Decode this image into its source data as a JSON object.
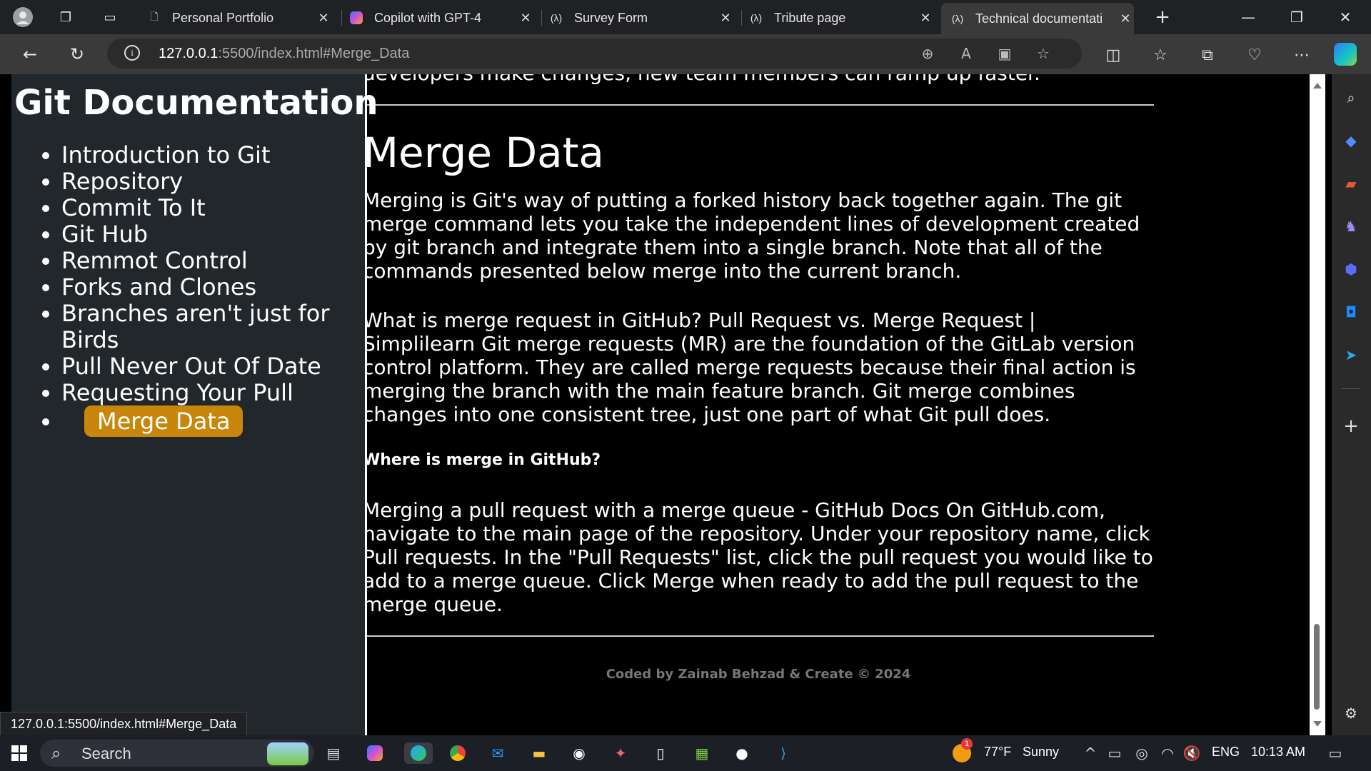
{
  "browser": {
    "tabs": [
      {
        "title": "Personal Portfolio",
        "icon": "page-icon"
      },
      {
        "title": "Copilot with GPT-4",
        "icon": "copilot-icon"
      },
      {
        "title": "Survey Form",
        "icon": "codepen-icon"
      },
      {
        "title": "Tribute page",
        "icon": "codepen-icon"
      },
      {
        "title": "Technical documentati",
        "icon": "codepen-icon"
      }
    ],
    "address": {
      "host": "127.0.0.1",
      "rest": ":5500/index.html#Merge_Data"
    },
    "status_url": "127.0.0.1:5500/index.html#Merge_Data"
  },
  "page": {
    "title": "Git Documentation",
    "nav": [
      "Introduction to Git",
      "Repository",
      "Commit To It",
      "Git Hub",
      "Remmot Control",
      "Forks and Clones",
      "Branches aren't just for Birds",
      "Pull Never Out Of Date",
      "Requesting Your Pull",
      "Merge Data"
    ],
    "prev_section_tail": "developers make changes, new team members can ramp up faster.",
    "section": {
      "title": "Merge Data",
      "p1": "Merging is Git's way of putting a forked history back together again. The git merge command lets you take the independent lines of development created by git branch and integrate them into a single branch. Note that all of the commands presented below merge into the current branch.",
      "p2": "What is merge request in GitHub? Pull Request vs. Merge Request | Simplilearn Git merge requests (MR) are the foundation of the GitLab version control platform. They are called merge requests because their final action is merging the branch with the main feature branch. Git merge combines changes into one consistent tree, just one part of what Git pull does.",
      "subhead": "Where is merge in GitHub?",
      "p3": "Merging a pull request with a merge queue - GitHub Docs On GitHub.com, navigate to the main page of the repository. Under your repository name, click Pull requests. In the \"Pull Requests\" list, click the pull request you would like to add to a merge queue. Click Merge when ready to add the pull request to the merge queue."
    },
    "footer": "Coded by Zainab Behzad & Create © 2024",
    "accent": "#c8860a"
  },
  "taskbar": {
    "search": "Search",
    "weather_temp": "77°F",
    "weather_cond": "Sunny",
    "lang": "ENG",
    "time": "10:13 AM",
    "notif_count": "1"
  }
}
